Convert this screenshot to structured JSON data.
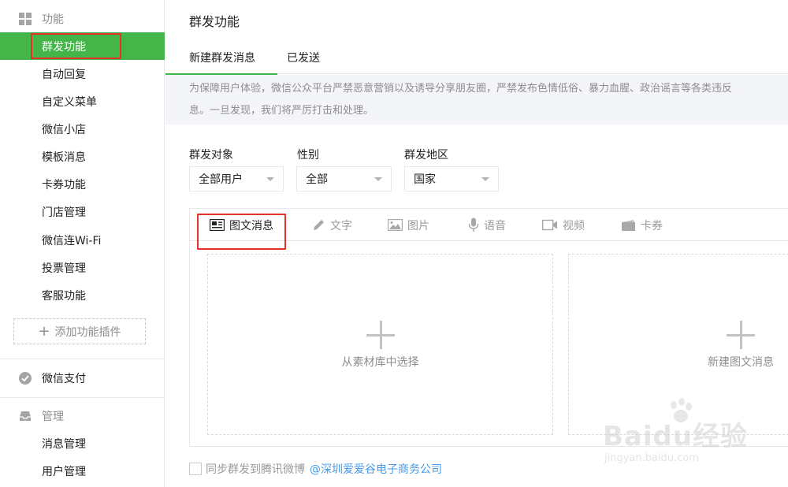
{
  "sidebar": {
    "sections": [
      {
        "label": "功能"
      },
      {
        "label": "微信支付"
      },
      {
        "label": "管理"
      }
    ],
    "function_items": [
      {
        "label": "群发功能",
        "active": true
      },
      {
        "label": "自动回复"
      },
      {
        "label": "自定义菜单"
      },
      {
        "label": "微信小店"
      },
      {
        "label": "模板消息"
      },
      {
        "label": "卡券功能"
      },
      {
        "label": "门店管理"
      },
      {
        "label": "微信连Wi-Fi"
      },
      {
        "label": "投票管理"
      },
      {
        "label": "客服功能"
      }
    ],
    "add_plugin_label": "添加功能插件",
    "manage_items": [
      {
        "label": "消息管理"
      },
      {
        "label": "用户管理"
      }
    ]
  },
  "main": {
    "title": "群发功能",
    "tabs": [
      {
        "label": "新建群发消息",
        "active": true
      },
      {
        "label": "已发送"
      }
    ],
    "notice_line1": "为保障用户体验，微信公众平台严禁恶意营销以及诱导分享朋友圈，严禁发布色情低俗、暴力血腥、政治谣言等各类违反",
    "notice_line2": "息。一旦发现，我们将严厉打击和处理。",
    "filters": {
      "target": {
        "label": "群发对象",
        "value": "全部用户"
      },
      "gender": {
        "label": "性别",
        "value": "全部"
      },
      "region": {
        "label": "群发地区",
        "value": "国家"
      }
    },
    "editor_tabs": [
      {
        "label": "图文消息",
        "icon": "news-icon",
        "active": true
      },
      {
        "label": "文字",
        "icon": "pencil-icon"
      },
      {
        "label": "图片",
        "icon": "image-icon"
      },
      {
        "label": "语音",
        "icon": "microphone-icon"
      },
      {
        "label": "视频",
        "icon": "video-icon"
      },
      {
        "label": "卡券",
        "icon": "card-icon"
      }
    ],
    "select_from_library": "从素材库中选择",
    "create_new_news": "新建图文消息",
    "sync_label": "同步群发到腾讯微博",
    "sync_account": "@深圳爱爱谷电子商务公司"
  },
  "watermark": {
    "brand": "Baidu经验",
    "url": "jingyan.baidu.com"
  },
  "colors": {
    "accent_green": "#44b549",
    "highlight_red": "#e5332a",
    "link_blue": "#459ae9"
  }
}
